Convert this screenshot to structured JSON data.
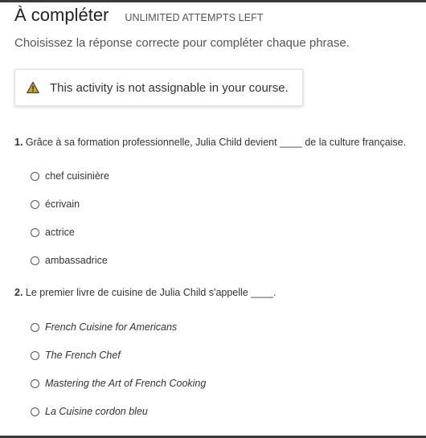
{
  "header": {
    "title": "À compléter",
    "attempts": "UNLIMITED ATTEMPTS LEFT"
  },
  "instructions": "Choisissez la réponse correcte pour compléter chaque phrase.",
  "notice": {
    "icon": "warning-icon",
    "icon_color": "#c9a227",
    "text": "This activity is not assignable in your course."
  },
  "questions": [
    {
      "number": "1.",
      "text": "Grâce à sa formation professionnelle, Julia Child devient ____ de la culture française.",
      "options": [
        "chef cuisinière",
        "écrivain",
        "actrice",
        "ambassadrice"
      ]
    },
    {
      "number": "2.",
      "text": "Le premier livre de cuisine de Julia Child s'appelle ____.",
      "options": [
        "French Cuisine for Americans",
        "The French Chef",
        "Mastering the Art of French Cooking",
        "La Cuisine cordon bleu"
      ]
    }
  ]
}
